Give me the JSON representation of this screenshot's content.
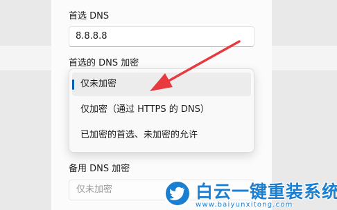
{
  "preferred_dns": {
    "label": "首选 DNS",
    "value": "8.8.8.8"
  },
  "preferred_encryption": {
    "label": "首选的 DNS 加密",
    "options": [
      {
        "label": "仅未加密",
        "selected": true
      },
      {
        "label": "仅加密（通过 HTTPS 的 DNS）",
        "selected": false
      },
      {
        "label": "已加密的首选、未加密的允许",
        "selected": false
      }
    ]
  },
  "alternate_encryption": {
    "label": "备用 DNS 加密",
    "value": "仅未加密"
  },
  "watermark": {
    "title": "白云一键重装系统",
    "url": "www.baiyunxitong.com",
    "icon": "bird-icon"
  },
  "colors": {
    "accent": "#005fb8",
    "arrow": "#e8393f",
    "watermark": "#1d7fd0"
  }
}
